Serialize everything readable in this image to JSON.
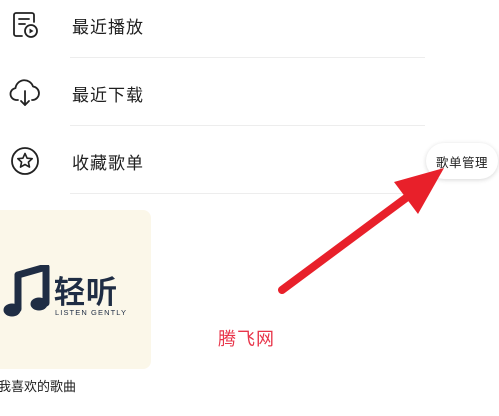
{
  "menu": {
    "items": [
      {
        "label": "最近播放",
        "icon": "recent-play-icon"
      },
      {
        "label": "最近下载",
        "icon": "cloud-download-icon"
      },
      {
        "label": "收藏歌单",
        "icon": "star-icon"
      }
    ],
    "manage_button_label": "歌单管理"
  },
  "playlist": {
    "title": "我喜欢的歌曲",
    "cover": {
      "logo_text": "轻听",
      "logo_subtitle": "LISTEN GENTLY",
      "logo_icon": "music-note-icon"
    }
  },
  "annotation": {
    "arrow_icon": "red-arrow-icon",
    "watermark": "腾飞网",
    "arrow_color": "#e8202a",
    "watermark_color": "#e8354a"
  },
  "colors": {
    "text": "#1f1f1f",
    "divider": "#ededed",
    "cover_background": "#fbf7e9",
    "logo_navy": "#1f2d44"
  }
}
